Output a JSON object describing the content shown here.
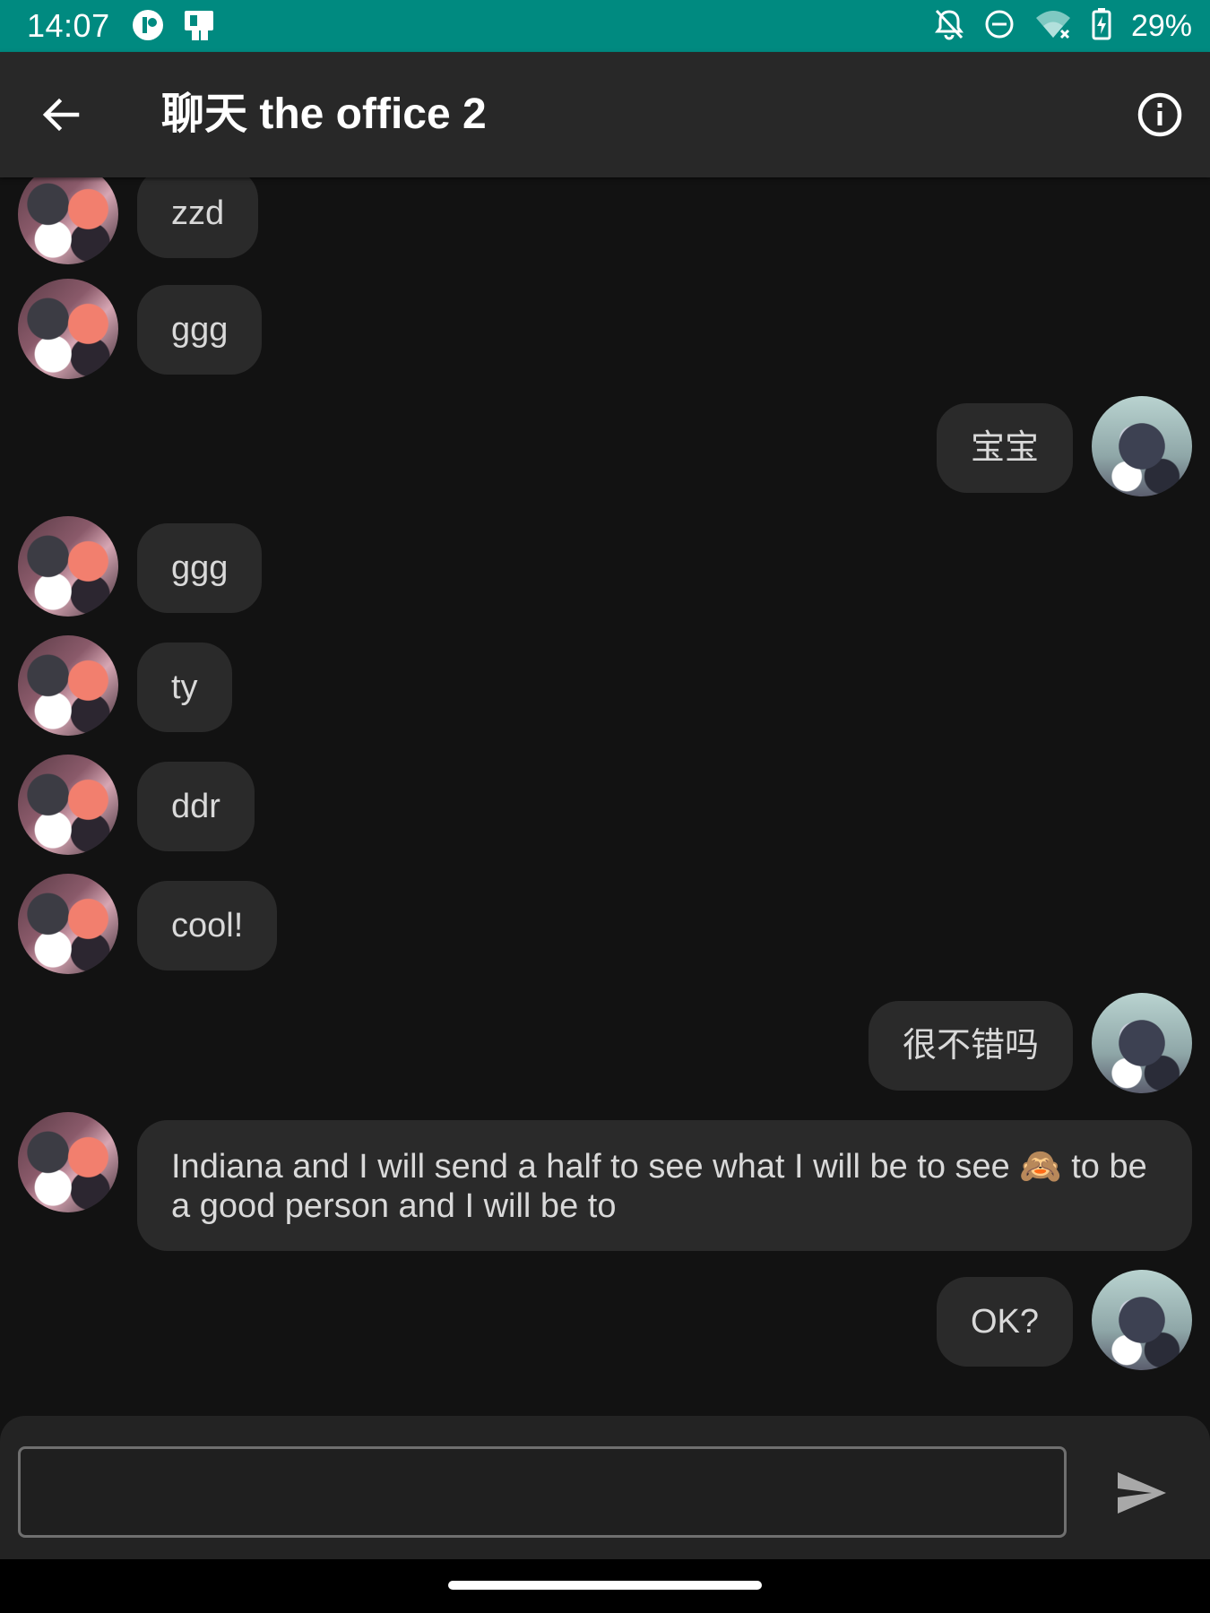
{
  "status_bar": {
    "time": "14:07",
    "left_icons": [
      "app-notification-icon",
      "sim-card-icon"
    ],
    "right_icons": [
      "notifications-off-icon",
      "do-not-disturb-icon",
      "wifi-no-internet-icon",
      "battery-charging-icon"
    ],
    "battery": "29%"
  },
  "app_bar": {
    "title": "聊天 the office 2",
    "back_icon": "arrow-left-icon",
    "info_icon": "info-icon"
  },
  "messages": [
    {
      "sender": "other",
      "text": "zzd"
    },
    {
      "sender": "other",
      "text": "ggg"
    },
    {
      "sender": "me",
      "text": "宝宝"
    },
    {
      "sender": "other",
      "text": "ggg"
    },
    {
      "sender": "other",
      "text": "ty"
    },
    {
      "sender": "other",
      "text": "ddr"
    },
    {
      "sender": "other",
      "text": "cool!"
    },
    {
      "sender": "me",
      "text": "很不错吗"
    },
    {
      "sender": "other",
      "text": "Indiana and I will send a half to see what I will be to see 🙈 to be a good person and I will be to"
    },
    {
      "sender": "me",
      "text": "OK?"
    }
  ],
  "composer": {
    "input_value": "",
    "input_placeholder": "",
    "send_icon": "send-icon"
  },
  "colors": {
    "status_bar": "#008a80",
    "app_bar": "#282828",
    "background": "#121212",
    "bubble": "#2a2a2a"
  }
}
